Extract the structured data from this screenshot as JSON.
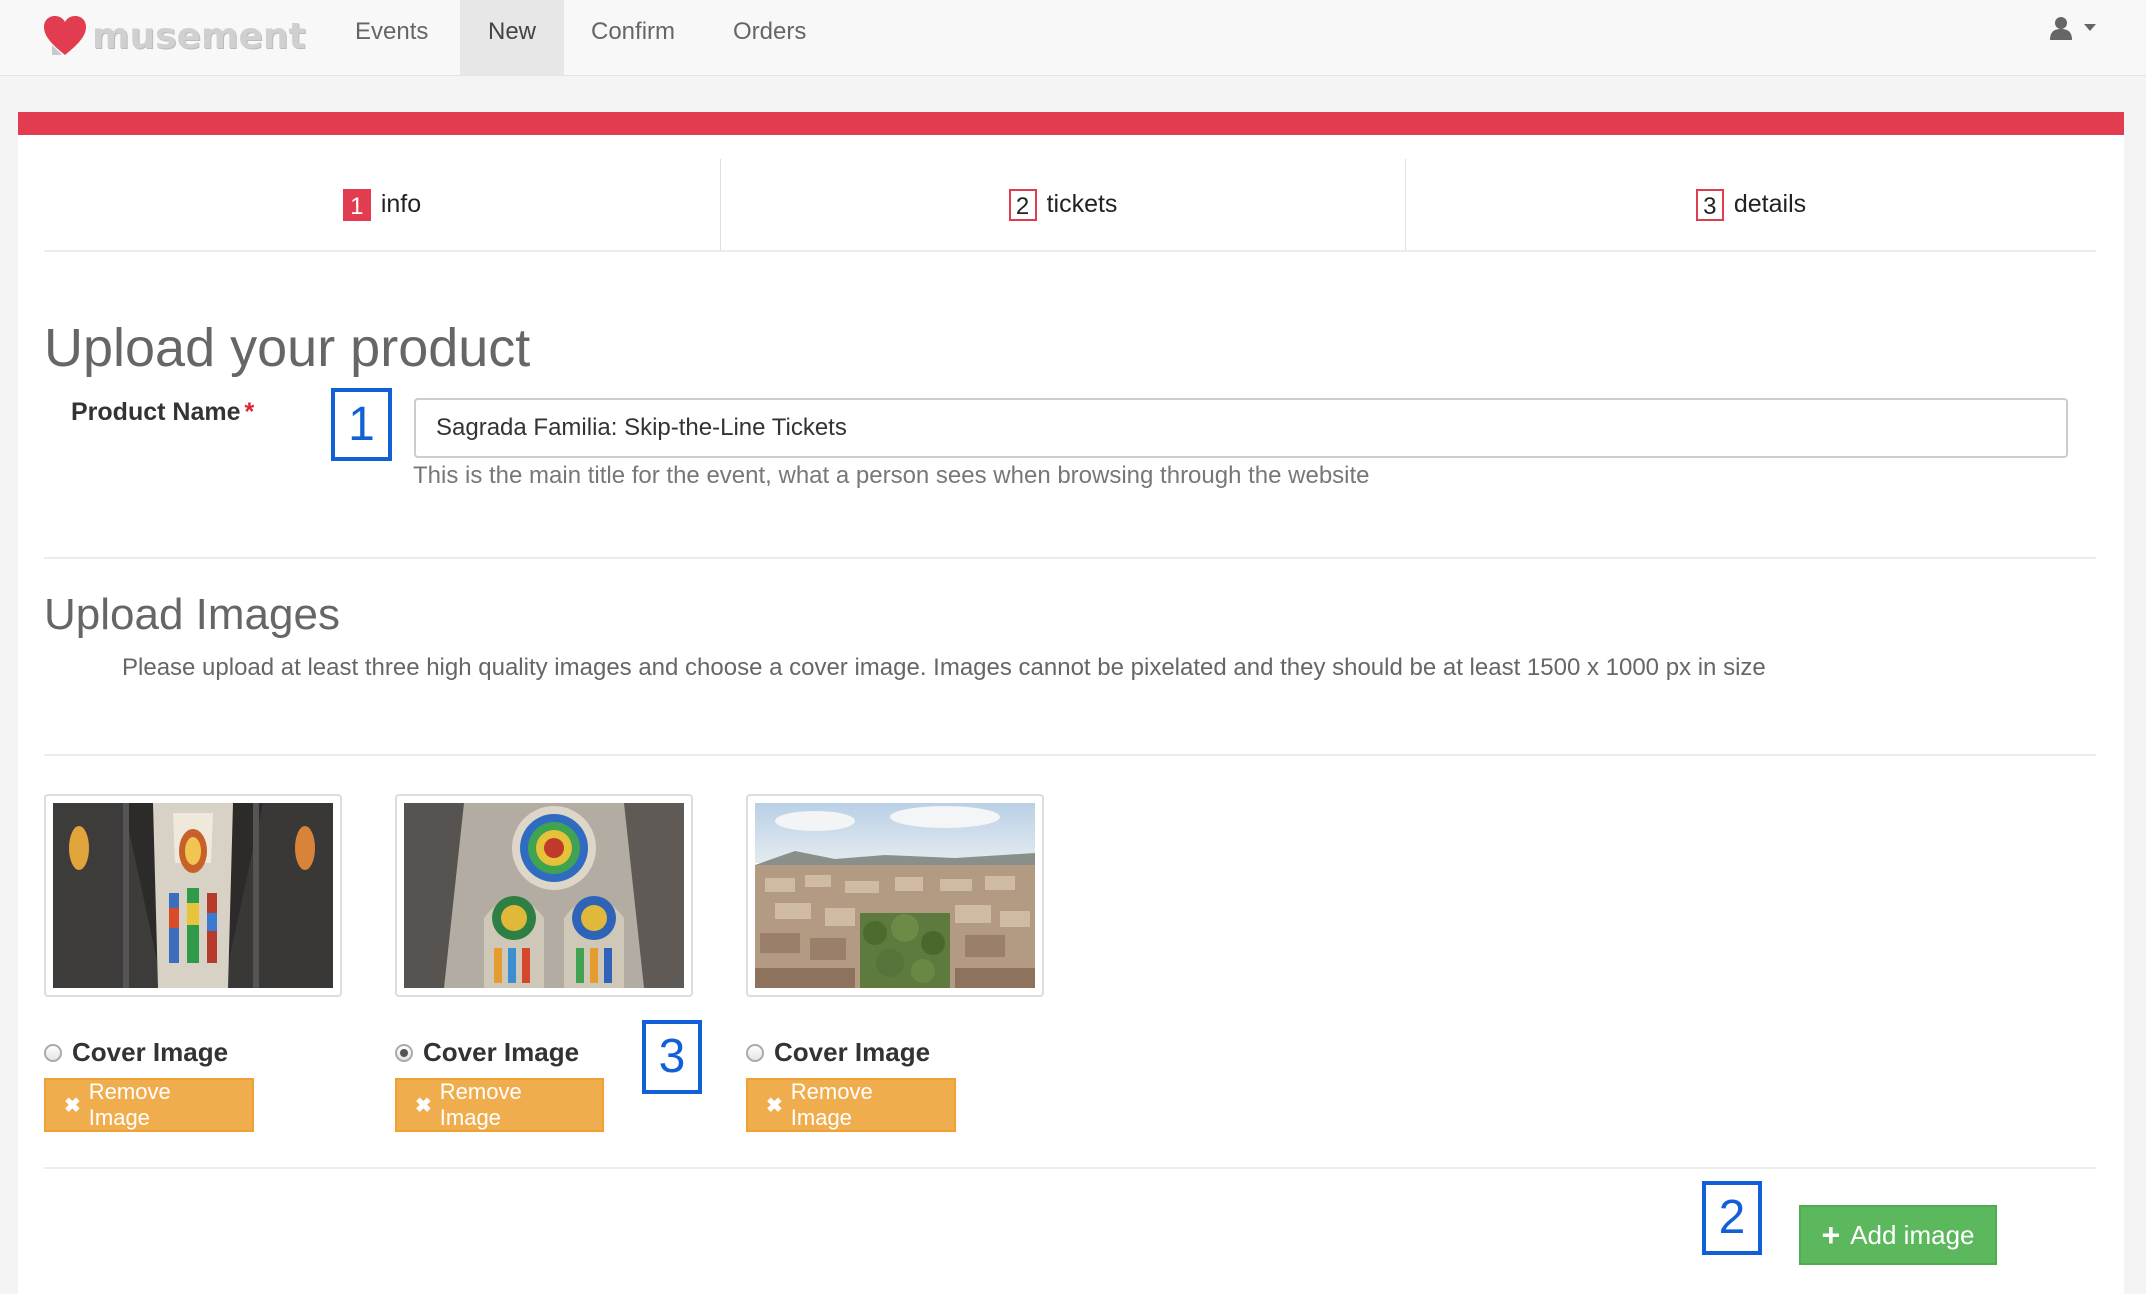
{
  "brand": {
    "name": "musement",
    "heart_color": "#e13c50"
  },
  "nav": {
    "items": [
      {
        "label": "Events"
      },
      {
        "label": "New",
        "active": true
      },
      {
        "label": "Confirm"
      },
      {
        "label": "Orders"
      }
    ],
    "user_icon": "user-icon",
    "caret_icon": "caret-down-icon"
  },
  "accent_color": "#e13c50",
  "steps": [
    {
      "num": "1",
      "label": "info",
      "active": true
    },
    {
      "num": "2",
      "label": "tickets"
    },
    {
      "num": "3",
      "label": "details"
    }
  ],
  "form": {
    "title": "Upload your product",
    "product_name_label": "Product Name",
    "required_mark": "*",
    "product_name_value": "Sagrada Familia: Skip-the-Line Tickets",
    "product_name_help": "This is the main title for the event, what a person sees when browsing through the website"
  },
  "images_section": {
    "title": "Upload Images",
    "instructions": "Please upload at least three high quality images and choose a cover image. Images cannot be pixelated and they should be at least 1500 x 1000 px in size",
    "images": [
      {
        "cover_label": "Cover Image",
        "cover_selected": false,
        "remove_label": "Remove Image"
      },
      {
        "cover_label": "Cover Image",
        "cover_selected": true,
        "remove_label": "Remove Image"
      },
      {
        "cover_label": "Cover Image",
        "cover_selected": false,
        "remove_label": "Remove Image"
      }
    ],
    "add_label": "Add image"
  },
  "annotations": [
    "1",
    "2",
    "3"
  ]
}
